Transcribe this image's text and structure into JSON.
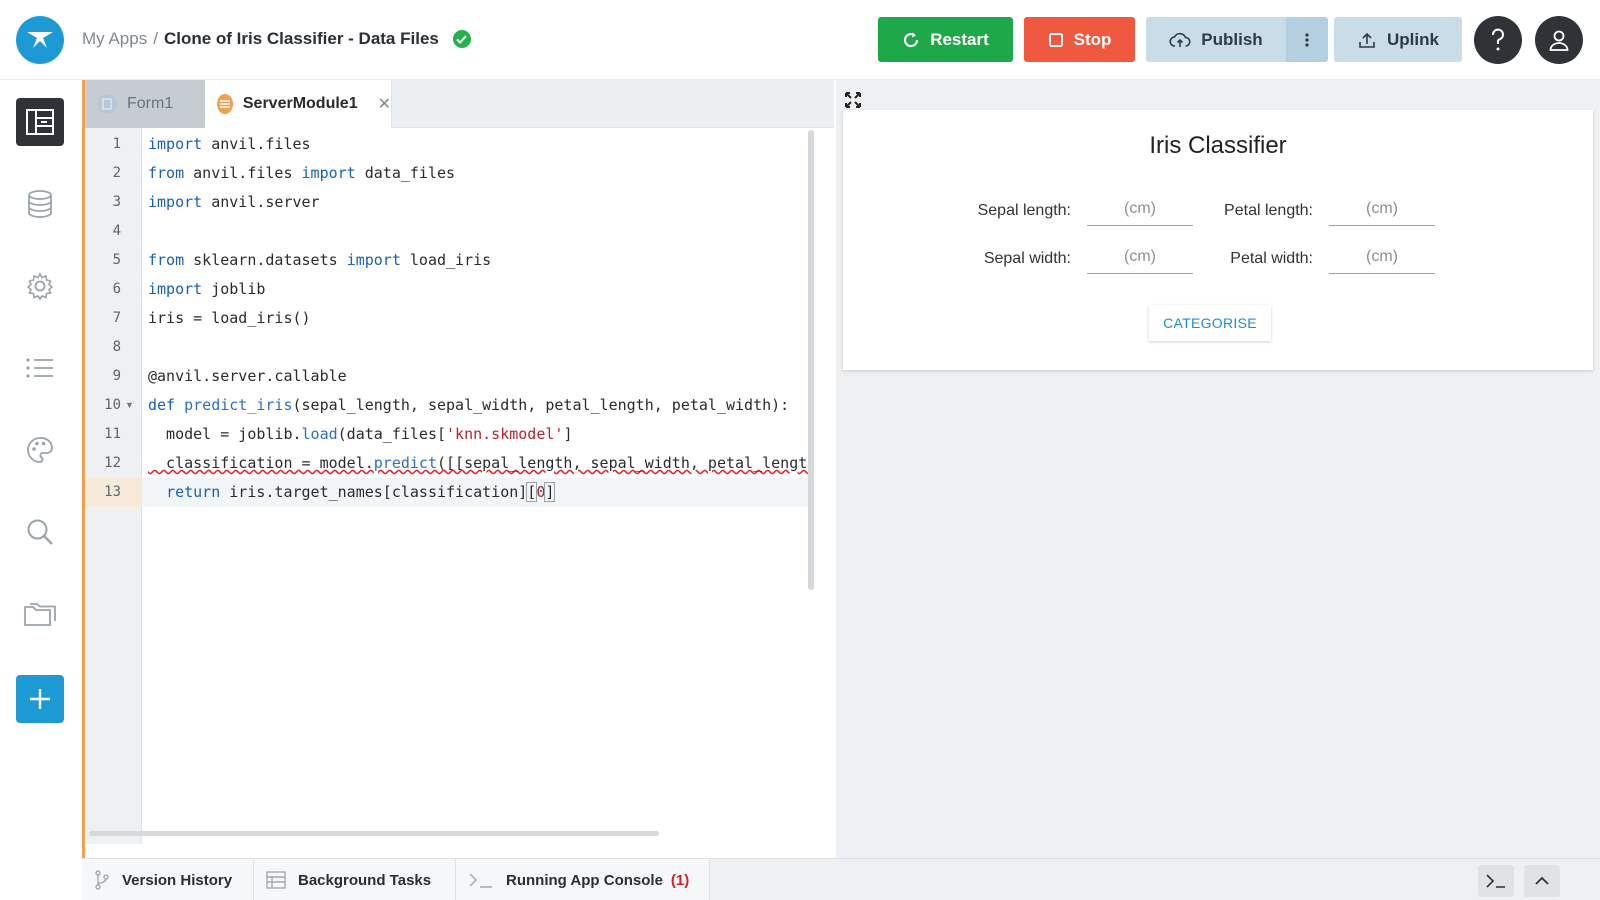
{
  "header": {
    "breadcrumb_parent": "My Apps",
    "breadcrumb_sep": "/",
    "app_title": "Clone of Iris Classifier - Data Files",
    "restart_label": "Restart",
    "stop_label": "Stop",
    "publish_label": "Publish",
    "uplink_label": "Uplink"
  },
  "sidebar": {
    "items": [
      "app-browser-icon",
      "database-icon",
      "gear-icon",
      "list-icon",
      "palette-icon",
      "search-icon",
      "folders-icon",
      "plus-icon"
    ]
  },
  "editor": {
    "tabs": [
      {
        "label": "Form1"
      },
      {
        "label": "ServerModule1"
      }
    ],
    "lines": [
      {
        "num": "1"
      },
      {
        "num": "2"
      },
      {
        "num": "3"
      },
      {
        "num": "4"
      },
      {
        "num": "5"
      },
      {
        "num": "6"
      },
      {
        "num": "7"
      },
      {
        "num": "8"
      },
      {
        "num": "9"
      },
      {
        "num": "10"
      },
      {
        "num": "11"
      },
      {
        "num": "12"
      },
      {
        "num": "13"
      }
    ],
    "code": {
      "import": "import",
      "from": "from",
      "def": "def",
      "return": "return",
      "l1_mod": " anvil.files",
      "l2_mod": " anvil.files ",
      "l2_name": " data_files",
      "l3_mod": " anvil.server",
      "l5_mod": " sklearn.datasets ",
      "l5_name": " load_iris",
      "l6_mod": " joblib",
      "l7": "iris = load_iris()",
      "l9": "@anvil.server.callable",
      "l10_fn": "predict_iris",
      "l10_args": "(sepal_length, sepal_width, petal_length, petal_width):",
      "l11_a": "  model = joblib.",
      "l11_fn": "load",
      "l11_b": "(data_files[",
      "l11_str": "'knn.skmodel'",
      "l11_c": "]",
      "l12_a": "  classification = model.",
      "l12_fn": "predict",
      "l12_b": "([[sepal_length, sepal_width, petal_length, petal_width]])",
      "l13_b": " iris.target_names[classification]",
      "l13_idx_open": "[",
      "l13_idx": "0",
      "l13_idx_close": "]"
    }
  },
  "preview": {
    "card_title": "Iris Classifier",
    "fields": [
      {
        "label": "Sepal length:",
        "placeholder": "(cm)"
      },
      {
        "label": "Petal length:",
        "placeholder": "(cm)"
      },
      {
        "label": "Sepal width:",
        "placeholder": "(cm)"
      },
      {
        "label": "Petal width:",
        "placeholder": "(cm)"
      }
    ],
    "button_label": "CATEGORISE"
  },
  "bottombar": {
    "version_history": "Version History",
    "background_tasks": "Background Tasks",
    "running_console": "Running App Console",
    "console_count": "(1)"
  },
  "colors": {
    "brand": "#1c9ad6",
    "restart": "#1ea84a",
    "stop": "#f0583f",
    "publish": "#c9dde9",
    "keyword": "#1a5fb4",
    "string": "#b3252f",
    "error": "#d0202c"
  }
}
